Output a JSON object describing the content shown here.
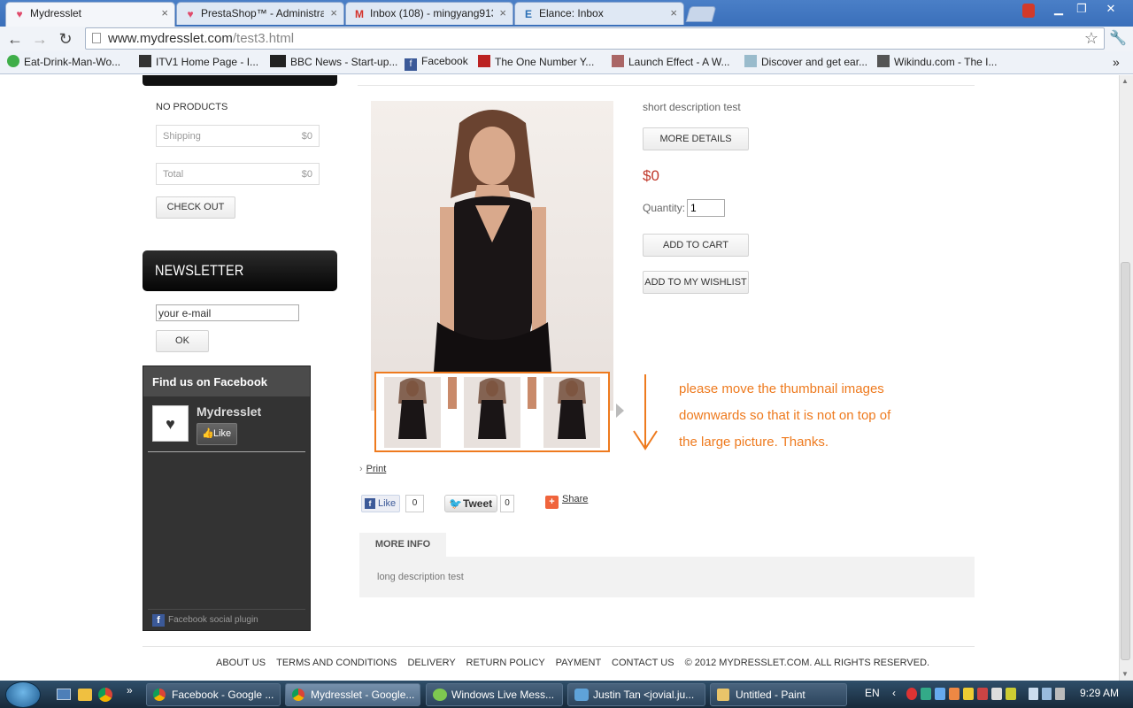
{
  "browser": {
    "tabs": [
      {
        "title": "Mydresslet",
        "icon": "heart-icon",
        "active": true
      },
      {
        "title": "PrestaShop™ - Administrat",
        "icon": "heart-icon",
        "active": false
      },
      {
        "title": "Inbox (108) - mingyang913",
        "icon": "gmail-icon",
        "active": false
      },
      {
        "title": "Elance: Inbox",
        "icon": "elance-icon",
        "active": false
      }
    ],
    "url_host": "www.mydresslet.com",
    "url_path": "/test3.html",
    "bookmarks": [
      {
        "label": "Eat-Drink-Man-Wo..."
      },
      {
        "label": "ITV1 Home Page - I..."
      },
      {
        "label": "BBC News - Start-up..."
      },
      {
        "label": "Facebook"
      },
      {
        "label": "The One Number Y..."
      },
      {
        "label": "Launch Effect - A W..."
      },
      {
        "label": "Discover and get ear..."
      },
      {
        "label": "Wikindu.com - The I..."
      }
    ]
  },
  "sidebar": {
    "cart": {
      "empty_label": "NO PRODUCTS",
      "shipping_label": "Shipping",
      "shipping_value": "$0",
      "total_label": "Total",
      "total_value": "$0",
      "checkout_label": "CHECK OUT"
    },
    "newsletter": {
      "title": "NEWSLETTER",
      "email_value": "your e-mail",
      "ok_label": "OK"
    },
    "facebook": {
      "title": "Find us on Facebook",
      "page_name": "Mydresslet",
      "like_label": "Like",
      "plugin_label": "Facebook social plugin"
    }
  },
  "product": {
    "short_description": "short description test",
    "more_details_label": "MORE DETAILS",
    "price": "$0",
    "quantity_label": "Quantity:",
    "quantity_value": "1",
    "add_to_cart_label": "ADD TO CART",
    "wishlist_label": "ADD TO MY WISHLIST",
    "print_label": "Print",
    "fb_like_label": "Like",
    "fb_like_count": "0",
    "tweet_label": "Tweet",
    "tweet_count": "0",
    "share_label": "Share",
    "more_info_tab": "MORE INFO",
    "long_description": "long description test"
  },
  "annotation": {
    "line1": "please move the thumbnail images",
    "line2": "downwards so that it is not on top of",
    "line3": "the large picture. Thanks.",
    "color": "#ee7a1e"
  },
  "footer": {
    "links": [
      "ABOUT US",
      "TERMS AND CONDITIONS",
      "DELIVERY",
      "RETURN POLICY",
      "PAYMENT",
      "CONTACT US"
    ],
    "copyright": "© 2012 MYDRESSLET.COM. ALL RIGHTS RESERVED."
  },
  "taskbar": {
    "items": [
      {
        "label": "Facebook - Google ...",
        "icon": "chrome-icon"
      },
      {
        "label": "Mydresslet - Google...",
        "icon": "chrome-icon"
      },
      {
        "label": "Windows Live Mess...",
        "icon": "messenger-icon"
      },
      {
        "label": "Justin Tan <jovial.ju...",
        "icon": "mail-icon"
      },
      {
        "label": "Untitled - Paint",
        "icon": "paint-icon"
      }
    ],
    "lang": "EN",
    "clock": "9:29 AM"
  }
}
